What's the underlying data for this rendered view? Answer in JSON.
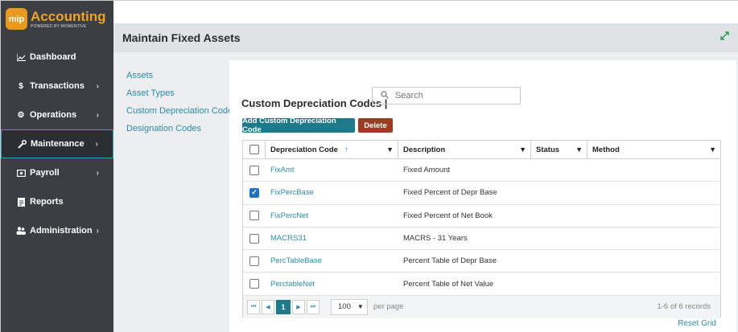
{
  "app": {
    "logo_badge": "mip",
    "logo_title": "Accounting",
    "logo_sub": "POWERED BY MOMENTIVE"
  },
  "sidebar": {
    "items": [
      {
        "label": "Dashboard",
        "icon": "chart-line-icon",
        "chevron": false
      },
      {
        "label": "Transactions",
        "icon": "dollar-icon",
        "chevron": true
      },
      {
        "label": "Operations",
        "icon": "gears-icon",
        "chevron": true
      },
      {
        "label": "Maintenance",
        "icon": "wrench-icon",
        "chevron": true,
        "active": true
      },
      {
        "label": "Payroll",
        "icon": "money-icon",
        "chevron": true
      },
      {
        "label": "Reports",
        "icon": "report-icon",
        "chevron": false
      },
      {
        "label": "Administration",
        "icon": "users-icon",
        "chevron": true
      }
    ]
  },
  "header": {
    "title": "Maintain Fixed Assets"
  },
  "submenu": {
    "items": [
      "Assets",
      "Asset Types",
      "Custom Depreciation Codes",
      "Designation Codes"
    ]
  },
  "panel": {
    "title": "Custom Depreciation Codes |",
    "search_placeholder": "Search",
    "add_label": "Add Custom Depreciation Code",
    "delete_label": "Delete"
  },
  "grid": {
    "columns": [
      "Depreciation Code",
      "Description",
      "Status",
      "Method"
    ],
    "rows": [
      {
        "code": "FixAmt",
        "description": "Fixed Amount",
        "checked": false
      },
      {
        "code": "FixPercBase",
        "description": "Fixed Percent of Depr Base",
        "checked": true
      },
      {
        "code": "FixPercNet",
        "description": "Fixed Percent of Net Book",
        "checked": false
      },
      {
        "code": "MACRS31",
        "description": "MACRS - 31 Years",
        "checked": false
      },
      {
        "code": "PercTableBase",
        "description": "Percent Table of Depr Base",
        "checked": false
      },
      {
        "code": "PerctableNet",
        "description": "Percent Table of Net Value",
        "checked": false
      }
    ],
    "pager": {
      "current_page": "1",
      "page_size": "100",
      "per_page_label": "per page",
      "records": "1-6 of 6 records"
    },
    "reset_label": "Reset Grid"
  },
  "colors": {
    "sidebar_bg": "#3b3f44",
    "accent": "#1c7a8a",
    "delete": "#a23a23",
    "link": "#2a8cab",
    "logo_orange": "#e99a1c"
  }
}
